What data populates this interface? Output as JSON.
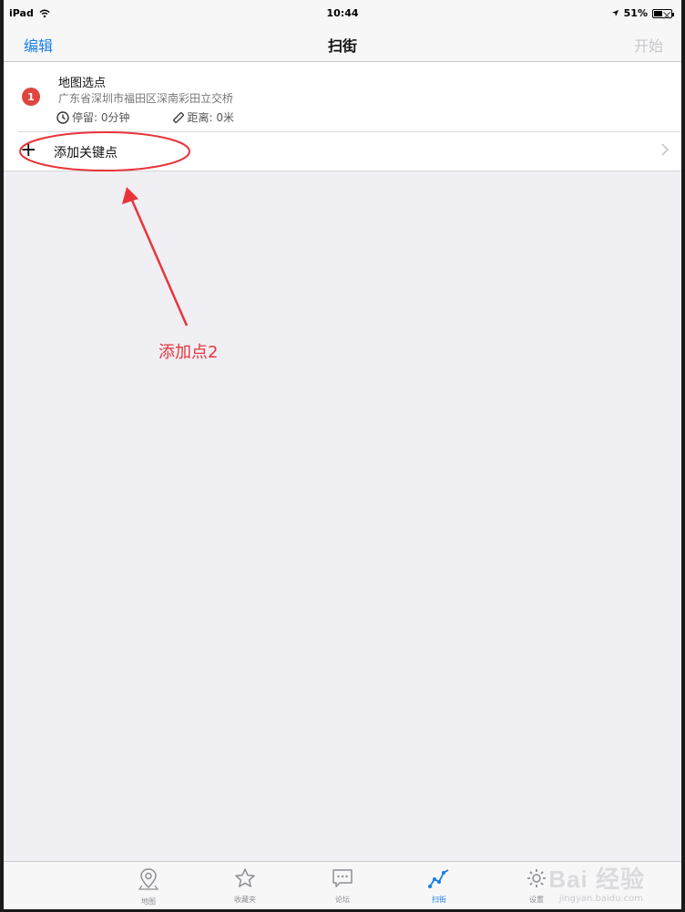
{
  "status_bar": {
    "device": "iPad",
    "time": "10:44",
    "battery": "51%",
    "battery_level": 0.51
  },
  "nav": {
    "left_label": "编辑",
    "title": "扫街",
    "right_label": "开始"
  },
  "waypoint": {
    "number": "1",
    "title": "地图选点",
    "address": "广东省深圳市福田区深南彩田立交桥",
    "stay": "停留: 0分钟",
    "distance": "距离: 0米"
  },
  "add_row": {
    "label": "添加关键点"
  },
  "annotation": {
    "text": "添加点2",
    "color": "#e8353a"
  },
  "tabs": [
    {
      "label": "地图",
      "icon": "map-pin-icon"
    },
    {
      "label": "收藏夹",
      "icon": "star-icon"
    },
    {
      "label": "论坛",
      "icon": "chat-icon"
    },
    {
      "label": "扫街",
      "icon": "route-icon",
      "active": true
    },
    {
      "label": "设置",
      "icon": "gear-icon"
    }
  ],
  "watermark": {
    "brand": "Bai 经验",
    "url": "jingyan.baidu.com"
  },
  "colors": {
    "accent": "#1a7fe5",
    "badge": "#e0443e"
  }
}
